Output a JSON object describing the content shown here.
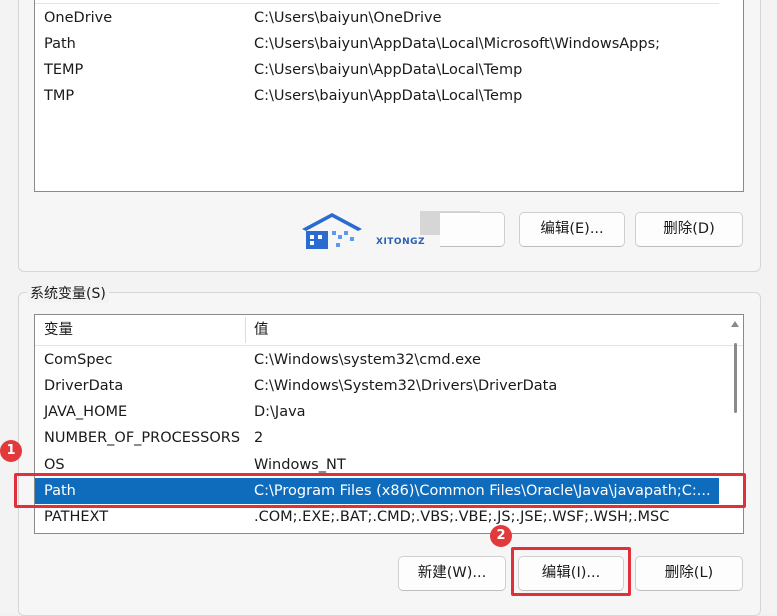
{
  "user_vars": {
    "rows": [
      {
        "name": "OneDrive",
        "value": "C:\\Users\\baiyun\\OneDrive"
      },
      {
        "name": "Path",
        "value": "C:\\Users\\baiyun\\AppData\\Local\\Microsoft\\WindowsApps;"
      },
      {
        "name": "TEMP",
        "value": "C:\\Users\\baiyun\\AppData\\Local\\Temp"
      },
      {
        "name": "TMP",
        "value": "C:\\Users\\baiyun\\AppData\\Local\\Temp"
      }
    ],
    "buttons": {
      "edit": "编辑(E)...",
      "delete": "删除(D)"
    }
  },
  "watermark": {
    "text": "XITONGZ"
  },
  "system_vars": {
    "label": "系统变量(S)",
    "headers": {
      "name": "变量",
      "value": "值"
    },
    "rows": [
      {
        "name": "ComSpec",
        "value": "C:\\Windows\\system32\\cmd.exe"
      },
      {
        "name": "DriverData",
        "value": "C:\\Windows\\System32\\Drivers\\DriverData"
      },
      {
        "name": "JAVA_HOME",
        "value": "D:\\Java"
      },
      {
        "name": "NUMBER_OF_PROCESSORS",
        "value": "2"
      },
      {
        "name": "OS",
        "value": "Windows_NT"
      },
      {
        "name": "Path",
        "value": "C:\\Program Files (x86)\\Common Files\\Oracle\\Java\\javapath;C:..."
      },
      {
        "name": "PATHEXT",
        "value": ".COM;.EXE;.BAT;.CMD;.VBS;.VBE;.JS;.JSE;.WSF;.WSH;.MSC"
      }
    ],
    "buttons": {
      "new": "新建(W)...",
      "edit": "编辑(I)...",
      "delete": "删除(L)"
    }
  },
  "markers": {
    "one": "1",
    "two": "2"
  },
  "colors": {
    "selection": "#0f6cbd",
    "annotation": "#e0313a"
  }
}
